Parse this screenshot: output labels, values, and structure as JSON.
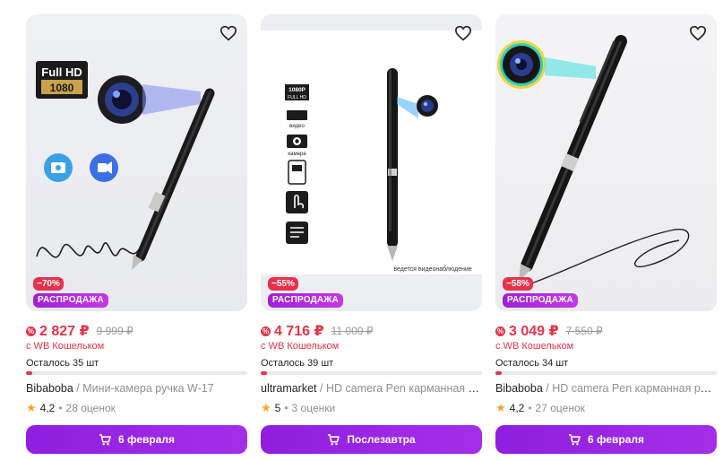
{
  "products": [
    {
      "image_labels": [
        "Full HD",
        "1080"
      ],
      "signature": "Summer",
      "discount": "−70%",
      "sale_label": "РАСПРОДАЖА",
      "price": "2 827 ₽",
      "old_price": "9 999 ₽",
      "wallet_text": "с WB Кошельком",
      "stock_text": "Осталось 35 шт",
      "stock_fraction": 0.03,
      "brand": "Bibaboba",
      "separator": " / ",
      "name": "Мини-камера ручка W-17",
      "rating": "4,2",
      "reviews": "28 оценок",
      "button_label": "6 февраля"
    },
    {
      "image_labels": [
        "1080P",
        "FULL HD",
        "видео",
        "камера",
        "ведется видеонаблюдение"
      ],
      "discount": "−55%",
      "sale_label": "РАСПРОДАЖА",
      "price": "4 716 ₽",
      "old_price": "11 000 ₽",
      "wallet_text": "с WB Кошельком",
      "stock_text": "Осталось 39 шт",
      "stock_fraction": 0.03,
      "brand": "ultramarket",
      "separator": " / ",
      "name": "HD camera Pen карманная камера",
      "rating": "5",
      "reviews": "3 оценки",
      "button_label": "Послезавтра"
    },
    {
      "discount": "−58%",
      "sale_label": "РАСПРОДАЖА",
      "price": "3 049 ₽",
      "old_price": "7 550 ₽",
      "wallet_text": "с WB Кошельком",
      "stock_text": "Осталось 34 шт",
      "stock_fraction": 0.03,
      "brand": "Bibaboba",
      "separator": " / ",
      "name": "HD camera Pen карманная ручка",
      "rating": "4,2",
      "reviews": "27 оценок",
      "button_label": "6 февраля"
    }
  ],
  "colors": {
    "price": "#e8324b",
    "accent_purple": "#9b27e4",
    "star": "#f5a623"
  },
  "icons": {
    "favorite": "heart-outline-icon",
    "cart": "cart-icon",
    "star": "star-icon",
    "wallet_discount": "wb-discount-icon"
  }
}
